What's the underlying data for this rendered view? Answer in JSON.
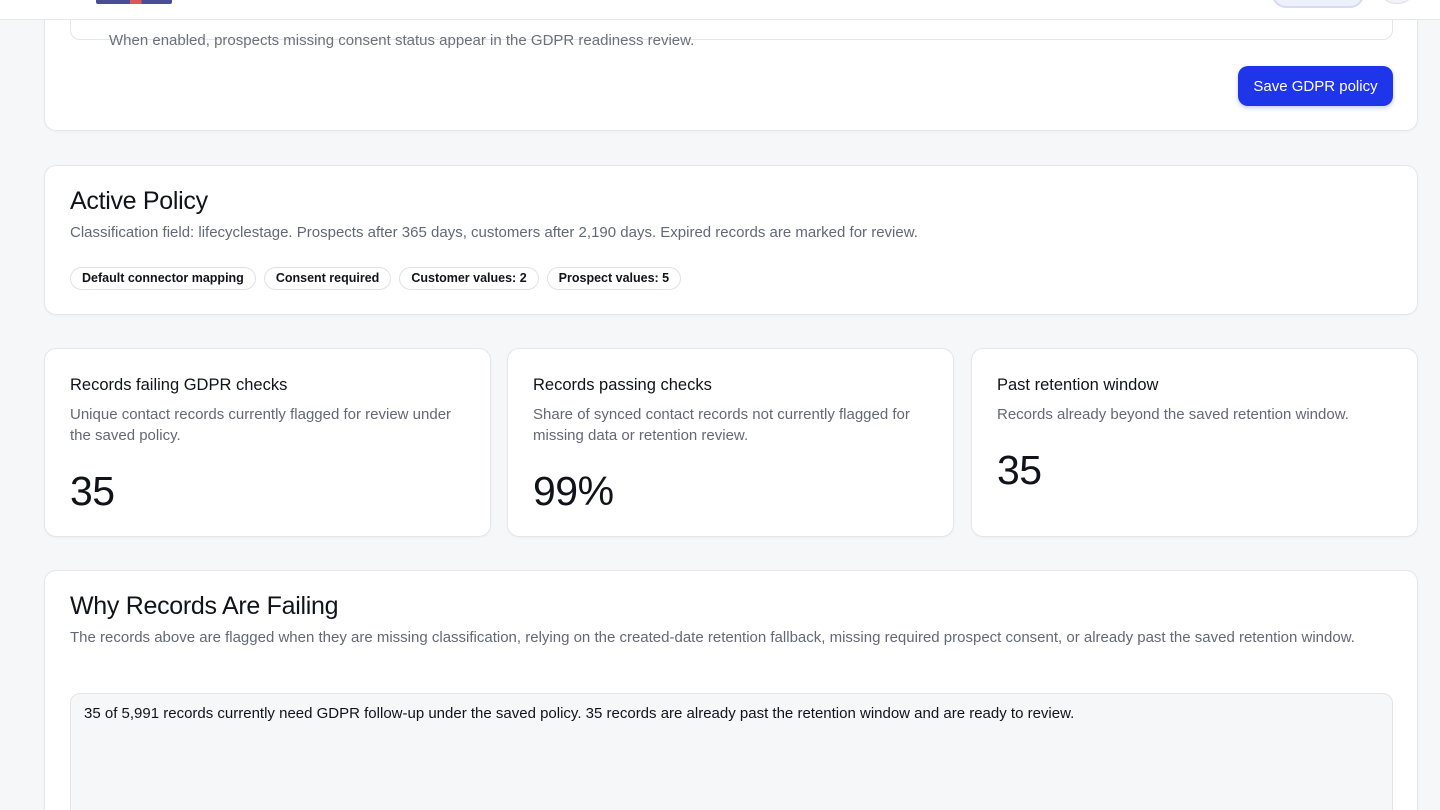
{
  "settings": {
    "consent_hint": "When enabled, prospects missing consent status appear in the GDPR readiness review.",
    "save_label": "Save GDPR policy"
  },
  "active_policy": {
    "title": "Active Policy",
    "description": "Classification field: lifecyclestage. Prospects after 365 days, customers after 2,190 days. Expired records are marked for review.",
    "chips": [
      "Default connector mapping",
      "Consent required",
      "Customer values: 2",
      "Prospect values: 5"
    ]
  },
  "metrics": [
    {
      "title": "Records failing GDPR checks",
      "description": "Unique contact records currently flagged for review under the saved policy.",
      "value": "35"
    },
    {
      "title": "Records passing checks",
      "description": "Share of synced contact records not currently flagged for missing data or retention review.",
      "value": "99%"
    },
    {
      "title": "Past retention window",
      "description": "Records already beyond the saved retention window.",
      "value": "35"
    }
  ],
  "why_failing": {
    "title": "Why Records Are Failing",
    "description": "The records above are flagged when they are missing classification, relying on the created-date retention fallback, missing required prospect consent, or already past the saved retention window.",
    "summary": "35 of 5,991 records currently need GDPR follow-up under the saved policy. 35 records are already past the retention window and are ready to review."
  },
  "colors": {
    "accent": "#1f35ea",
    "background": "#f6f7f9",
    "text": "#11131a",
    "muted": "#626875",
    "border": "#e4e6eb"
  }
}
